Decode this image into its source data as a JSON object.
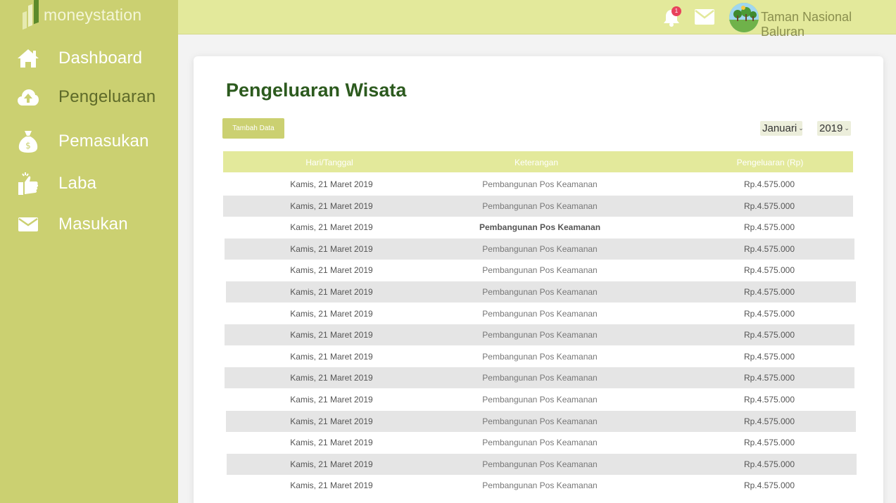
{
  "app": {
    "logo_text": "moneystation"
  },
  "sidebar": {
    "items": [
      {
        "label": "Dashboard",
        "icon": "home-icon",
        "active": false
      },
      {
        "label": "Pengeluaran",
        "icon": "cloud-upload-icon",
        "active": true
      },
      {
        "label": "Pemasukan",
        "icon": "money-bag-icon",
        "active": false
      },
      {
        "label": "Laba",
        "icon": "thumbs-up-icon",
        "active": false
      },
      {
        "label": "Masukan",
        "icon": "envelope-icon",
        "active": false
      }
    ]
  },
  "topbar": {
    "notification_count": "1",
    "user_name": "Taman Nasional Baluran"
  },
  "main": {
    "title": "Pengeluaran Wisata",
    "add_button": "Tambah Data",
    "month_select": "Januari",
    "year_select": "2019",
    "table": {
      "headers": [
        "Hari/Tanggal",
        "Keterangan",
        "Pengeluaran (Rp)"
      ],
      "rows": [
        [
          "Kamis, 21 Maret 2019",
          "Pembangunan Pos Keamanan",
          "Rp.4.575.000"
        ],
        [
          "Kamis, 21 Maret 2019",
          "Pembangunan Pos Keamanan",
          "Rp.4.575.000"
        ],
        [
          "Kamis, 21 Maret 2019",
          "Pembangunan Pos Keamanan",
          "Rp.4.575.000"
        ],
        [
          "Kamis, 21 Maret 2019",
          "Pembangunan Pos Keamanan",
          "Rp.4.575.000"
        ],
        [
          "Kamis, 21 Maret 2019",
          "Pembangunan Pos Keamanan",
          "Rp.4.575.000"
        ],
        [
          "Kamis, 21 Maret 2019",
          "Pembangunan Pos Keamanan",
          "Rp.4.575.000"
        ],
        [
          "Kamis, 21 Maret 2019",
          "Pembangunan Pos Keamanan",
          "Rp.4.575.000"
        ],
        [
          "Kamis, 21 Maret 2019",
          "Pembangunan Pos Keamanan",
          "Rp.4.575.000"
        ],
        [
          "Kamis, 21 Maret 2019",
          "Pembangunan Pos Keamanan",
          "Rp.4.575.000"
        ],
        [
          "Kamis, 21 Maret 2019",
          "Pembangunan Pos Keamanan",
          "Rp.4.575.000"
        ],
        [
          "Kamis, 21 Maret 2019",
          "Pembangunan Pos Keamanan",
          "Rp.4.575.000"
        ],
        [
          "Kamis, 21 Maret 2019",
          "Pembangunan Pos Keamanan",
          "Rp.4.575.000"
        ],
        [
          "Kamis, 21 Maret 2019",
          "Pembangunan Pos Keamanan",
          "Rp.4.575.000"
        ],
        [
          "Kamis, 21 Maret 2019",
          "Pembangunan Pos Keamanan",
          "Rp.4.575.000"
        ],
        [
          "Kamis, 21 Maret 2019",
          "Pembangunan Pos Keamanan",
          "Rp.4.575.000"
        ]
      ]
    }
  },
  "colors": {
    "sidebar": "#cbd071",
    "topbar": "#e3e99b",
    "title": "#2c5a1e",
    "badge": "#e8425c"
  }
}
